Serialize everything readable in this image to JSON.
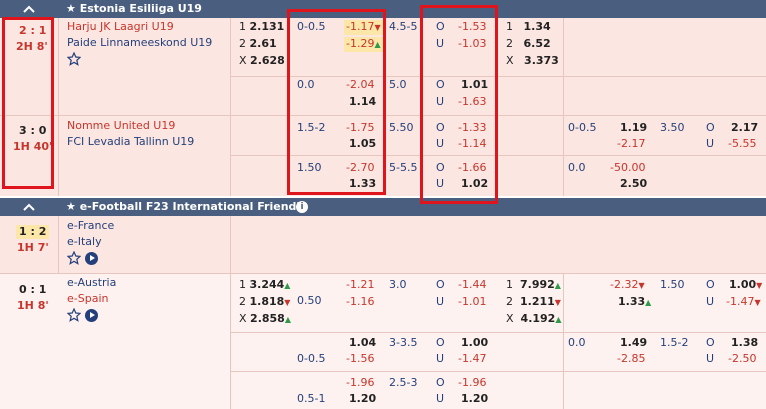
{
  "league1": {
    "name": "Estonia Esiliiga U19"
  },
  "league2": {
    "name": "e-Football F23 International Friendly"
  },
  "m1": {
    "score": "2 : 1",
    "time": "2H 8'",
    "home": "Harju JK Laagri U19",
    "away": "Paide Linnameeskond U19",
    "x1": {
      "l1": "1",
      "v1": "2.131",
      "l2": "2",
      "v2": "2.61",
      "l3": "X",
      "v3": "2.628"
    },
    "hdp": "0-0.5",
    "hdp_h": "-1.17",
    "hdp_a": "-1.29",
    "ou": "4.5-5",
    "o_lab": "O",
    "o": "-1.53",
    "u_lab": "U",
    "u": "-1.03",
    "h1": {
      "l1": "1",
      "v1": "1.34",
      "l2": "2",
      "v2": "6.52",
      "l3": "X",
      "v3": "3.373"
    },
    "r2": {
      "hdp": "0.0",
      "hdp_h": "-2.04",
      "hdp_a": "1.14",
      "ou": "5.0",
      "o": "1.01",
      "u": "-1.63"
    }
  },
  "m2": {
    "score": "3 : 0",
    "time": "1H 40'",
    "home": "Nomme United U19",
    "away": "FCI Levadia Tallinn U19",
    "hdp": "1.5-2",
    "hdp_h": "-1.75",
    "hdp_a": "1.05",
    "ou": "5.50",
    "o": "-1.33",
    "u": "-1.14",
    "h_hdp": "0-0.5",
    "h_hdp_h": "1.19",
    "h_hdp_a": "-2.17",
    "h_ou": "3.50",
    "h_o": "2.17",
    "h_u": "-5.55",
    "r2": {
      "hdp": "1.50",
      "hdp_h": "-2.70",
      "hdp_a": "1.33",
      "ou": "5-5.5",
      "o": "-1.66",
      "u": "1.02",
      "h_hdp": "0.0",
      "h_hdp_h": "-50.00",
      "h_hdp_a": "2.50"
    }
  },
  "m3": {
    "score": "1 : 2",
    "time": "1H 7'",
    "home": "e-France",
    "away": "e-Italy"
  },
  "m4": {
    "score": "0 : 1",
    "time": "1H 8'",
    "home": "e-Austria",
    "away": "e-Spain",
    "x1": {
      "v1": "3.244",
      "v2": "1.818",
      "v3": "2.858"
    },
    "hdp": "0.50",
    "hdp_h": "-1.21",
    "hdp_a": "-1.16",
    "ou": "3.0",
    "o": "-1.44",
    "u": "-1.01",
    "h1": {
      "v1": "7.992",
      "v2": "1.211",
      "v3": "4.192"
    },
    "h_hdp_h": "-2.32",
    "h_hdp_a": "1.33",
    "h_ou": "1.50",
    "h_o": "1.00",
    "h_u": "-1.47",
    "r2": {
      "hdp": "0-0.5",
      "hdp_h": "1.04",
      "hdp_a": "-1.56",
      "ou": "3-3.5",
      "o": "1.00",
      "u": "-1.47",
      "h_hdp": "0.0",
      "h_hdp_h": "1.49",
      "h_hdp_a": "-2.85",
      "h_ou": "1.5-2",
      "h_o": "1.38",
      "h_u": "-2.50"
    },
    "r3": {
      "hdp": "0.5-1",
      "hdp_h": "-1.96",
      "hdp_a": "1.20",
      "ou": "2.5-3",
      "o": "-1.96",
      "u": "1.20"
    }
  },
  "colors": {
    "header": "#4a5f80",
    "row": "#fbe6e1",
    "odds_red": "#c8352c",
    "team_blue": "#243f7a",
    "highlight_box": "#e0141d"
  }
}
